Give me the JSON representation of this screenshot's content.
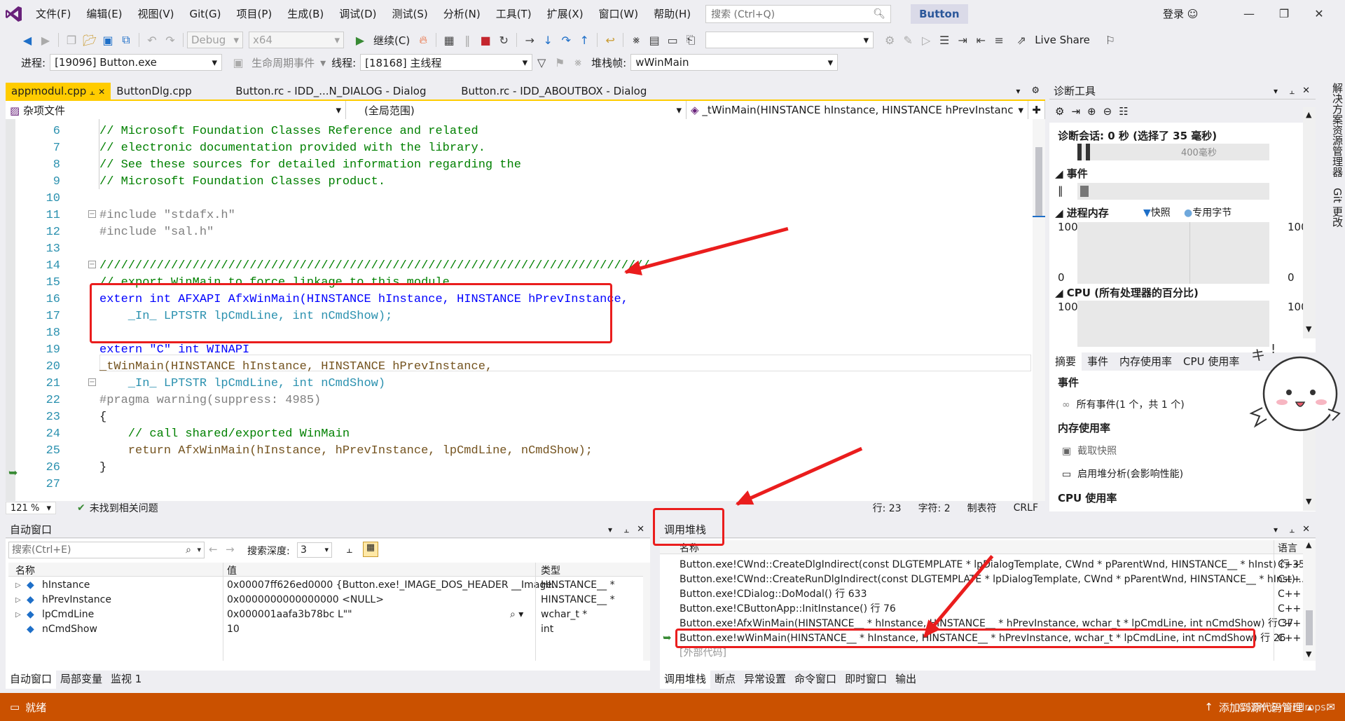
{
  "menubar": {
    "items": [
      "文件(F)",
      "编辑(E)",
      "视图(V)",
      "Git(G)",
      "项目(P)",
      "生成(B)",
      "调试(D)",
      "测试(S)",
      "分析(N)",
      "工具(T)",
      "扩展(X)",
      "窗口(W)",
      "帮助(H)"
    ],
    "search_placeholder": "搜索 (Ctrl+Q)",
    "solution_name": "Button",
    "login": "登录"
  },
  "toolbar1": {
    "config": "Debug",
    "platform": "x64",
    "continue_label": "继续(C)",
    "live_share": "Live Share"
  },
  "toolbar2": {
    "process_label": "进程:",
    "process_value": "[19096] Button.exe",
    "lifecycle_label": "生命周期事件",
    "thread_label": "线程:",
    "thread_value": "[18168] 主线程",
    "stackframe_label": "堆栈帧:",
    "stackframe_value": "wWinMain"
  },
  "editor": {
    "tabs": [
      "appmodul.cpp",
      "ButtonDlg.cpp",
      "Button.rc - IDD_...N_DIALOG - Dialog",
      "Button.rc - IDD_ABOUTBOX - Dialog"
    ],
    "nav": {
      "project": "杂项文件",
      "scope": "(全局范围)",
      "member": "_tWinMain(HINSTANCE hInstance, HINSTANCE hPrevInstance"
    },
    "zoom": "121 %",
    "issues": "未找到相关问题",
    "row": "行: 23",
    "col": "字符: 2",
    "tabs_mode": "制表符",
    "eol": "CRLF"
  },
  "code": [
    {
      "n": "6",
      "t": "// Microsoft Foundation Classes Reference and related"
    },
    {
      "n": "7",
      "t": "// electronic documentation provided with the library."
    },
    {
      "n": "8",
      "t": "// See these sources for detailed information regarding the"
    },
    {
      "n": "9",
      "t": "// Microsoft Foundation Classes product."
    },
    {
      "n": "10",
      "t": ""
    },
    {
      "n": "11",
      "t": "#include \"stdafx.h\""
    },
    {
      "n": "12",
      "t": "#include \"sal.h\""
    },
    {
      "n": "13",
      "t": ""
    },
    {
      "n": "14",
      "t": "/////////////////////////////////////////////////////////////////////////////"
    },
    {
      "n": "15",
      "t": "// export WinMain to force linkage to this module"
    },
    {
      "n": "16",
      "t": "extern int AFXAPI AfxWinMain(HINSTANCE hInstance, HINSTANCE hPrevInstance,"
    },
    {
      "n": "17",
      "t": "    _In_ LPTSTR lpCmdLine, int nCmdShow);"
    },
    {
      "n": "18",
      "t": ""
    },
    {
      "n": "19",
      "t": "extern \"C\" int WINAPI"
    },
    {
      "n": "20",
      "t": "_tWinMain(HINSTANCE hInstance, HINSTANCE hPrevInstance,"
    },
    {
      "n": "21",
      "t": "    _In_ LPTSTR lpCmdLine, int nCmdShow)"
    },
    {
      "n": "22",
      "t": "#pragma warning(suppress: 4985)"
    },
    {
      "n": "23",
      "t": "{"
    },
    {
      "n": "24",
      "t": "    // call shared/exported WinMain"
    },
    {
      "n": "25",
      "t": "    return AfxWinMain(hInstance, hPrevInstance, lpCmdLine, nCmdShow);"
    },
    {
      "n": "26",
      "t": "}"
    },
    {
      "n": "27",
      "t": ""
    }
  ],
  "diag": {
    "title": "诊断工具",
    "session": "诊断会话: 0 秒 (选择了 35 毫秒)",
    "timeline_label": "400毫秒",
    "events": "事件",
    "memory": "进程内存",
    "snapshot": "快照",
    "private_bytes": "专用字节",
    "mem_max": "100",
    "mem_min": "0",
    "cpu": "CPU (所有处理器的百分比)",
    "cpu_max": "100",
    "tabs": [
      "摘要",
      "事件",
      "内存使用率",
      "CPU 使用率"
    ],
    "events_section": "事件",
    "all_events": "所有事件(1 个，共 1 个)",
    "mem_section": "内存使用率",
    "take_snapshot": "截取快照",
    "heap_profile": "启用堆分析(会影响性能)",
    "cpu_section": "CPU 使用率"
  },
  "side_tabs": [
    "解决方案资源管理器",
    "Git 更改"
  ],
  "autos": {
    "title": "自动窗口",
    "search_placeholder": "搜索(Ctrl+E)",
    "depth_label": "搜索深度:",
    "depth_value": "3",
    "columns": [
      "名称",
      "值",
      "类型"
    ],
    "rows": [
      {
        "name": "hInstance",
        "value": "0x00007ff626ed0000 {Button.exe!_IMAGE_DOS_HEADER __Image...",
        "type": "HINSTANCE__ *"
      },
      {
        "name": "hPrevInstance",
        "value": "0x0000000000000000 <NULL>",
        "type": "HINSTANCE__ *"
      },
      {
        "name": "lpCmdLine",
        "value": "0x000001aafa3b78bc L\"\"",
        "type": "wchar_t *"
      },
      {
        "name": "nCmdShow",
        "value": "10",
        "type": "int"
      }
    ],
    "tabs": [
      "自动窗口",
      "局部变量",
      "监视 1"
    ]
  },
  "callstack": {
    "title": "调用堆栈",
    "columns": [
      "名称",
      "语言"
    ],
    "rows": [
      {
        "name": "Button.exe!CWnd::CreateDlgIndirect(const DLGTEMPLATE * lpDialogTemplate, CWnd * pParentWnd, HINSTANCE__ * hInst) 行 358",
        "lang": "C++"
      },
      {
        "name": "Button.exe!CWnd::CreateRunDlgIndirect(const DLGTEMPLATE * lpDialogTemplate, CWnd * pParentWnd, HINSTANCE__ * hInst) ...",
        "lang": "C++"
      },
      {
        "name": "Button.exe!CDialog::DoModal() 行 633",
        "lang": "C++"
      },
      {
        "name": "Button.exe!CButtonApp::InitInstance() 行 76",
        "lang": "C++"
      },
      {
        "name": "Button.exe!AfxWinMain(HINSTANCE__ * hInstance, HINSTANCE__ * hPrevInstance, wchar_t * lpCmdLine, int nCmdShow) 行 37",
        "lang": "C++"
      },
      {
        "name": "Button.exe!wWinMain(HINSTANCE__ * hInstance, HINSTANCE__ * hPrevInstance, wchar_t * lpCmdLine, int nCmdShow) 行 26",
        "lang": "C++"
      },
      {
        "name": "[外部代码]",
        "lang": ""
      }
    ],
    "tabs": [
      "调用堆栈",
      "断点",
      "异常设置",
      "命令窗口",
      "即时窗口",
      "输出"
    ]
  },
  "status": {
    "ready": "就绪",
    "source_control": "添加到源代码管理",
    "watermark": "CSDN @raindrops."
  },
  "colors": {
    "accent": "#007acc",
    "status": "#ca5100",
    "highlight": "#ea1d1d",
    "tab_active": "#ffcc00"
  }
}
